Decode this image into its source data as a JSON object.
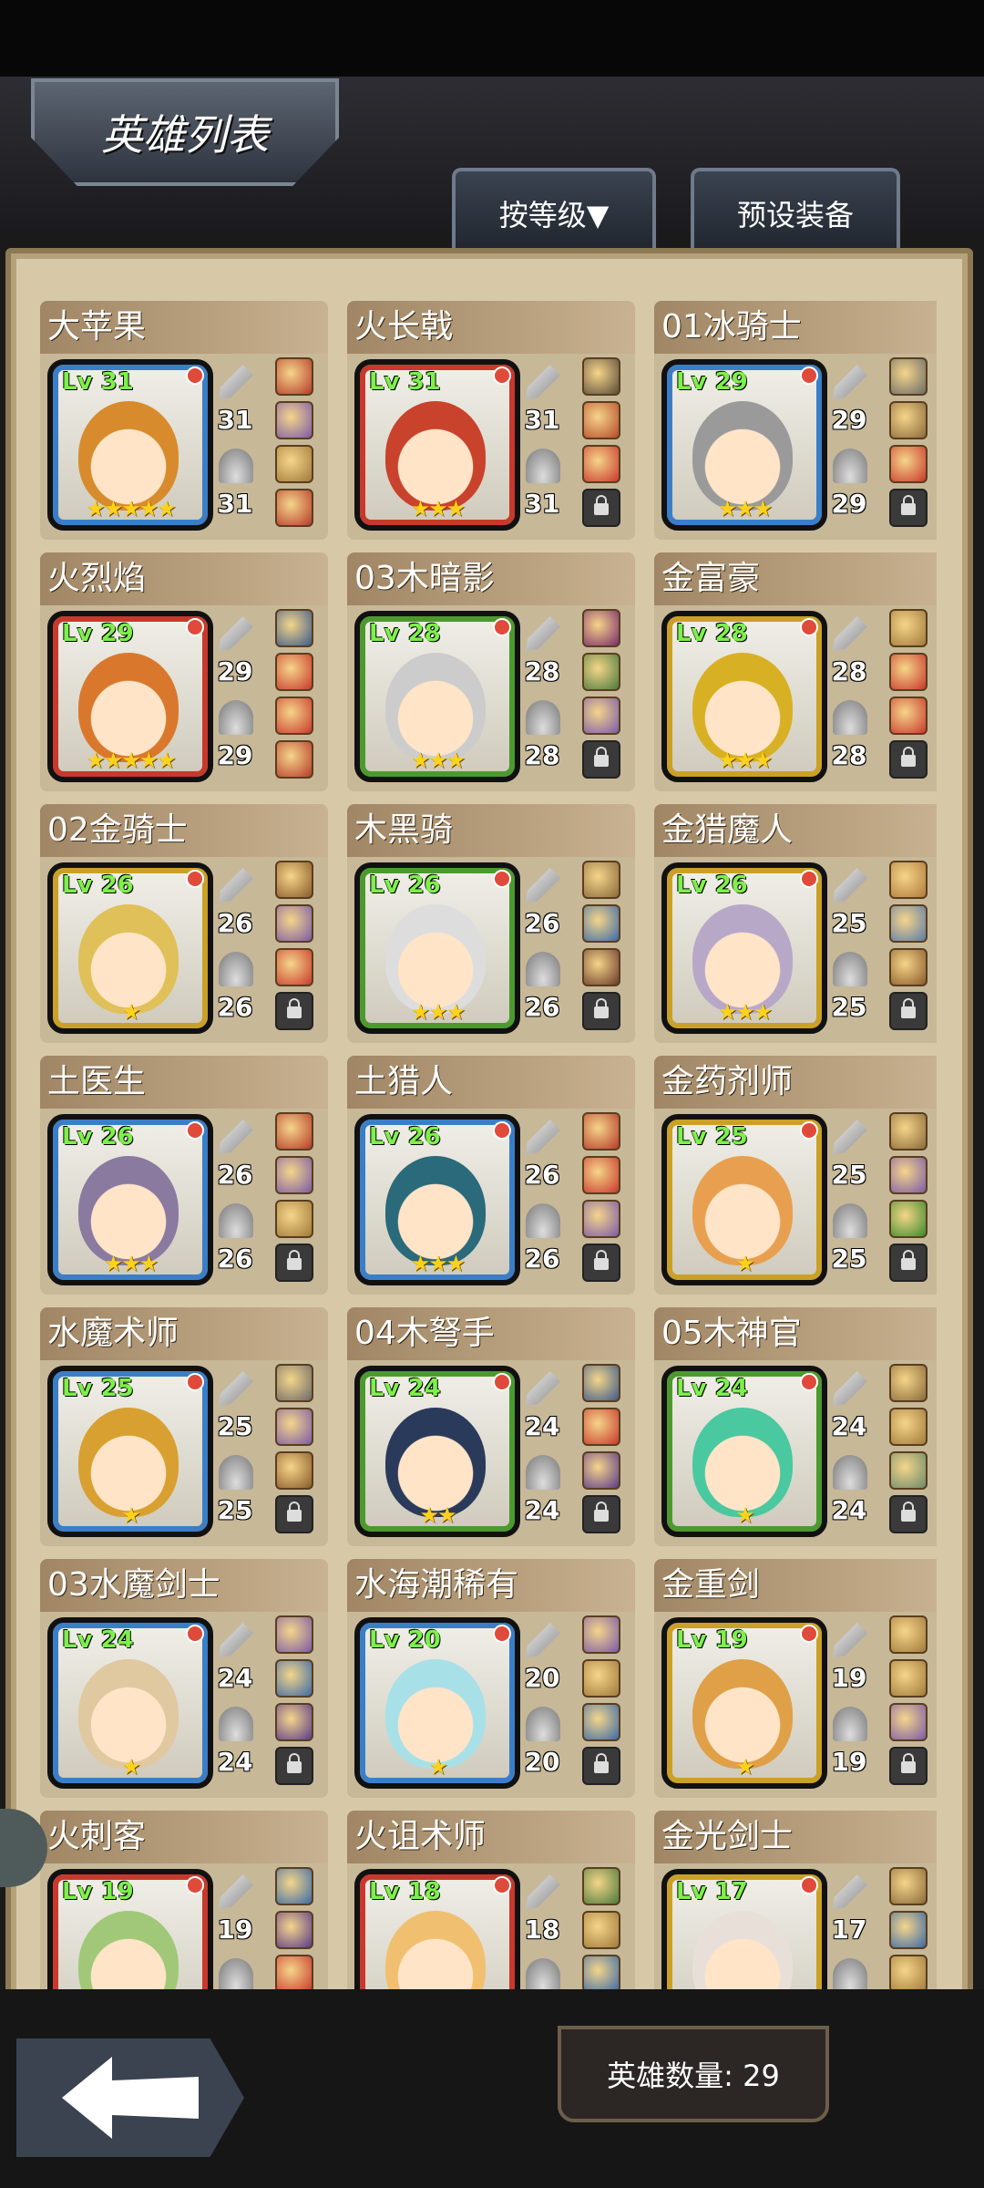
{
  "header": {
    "title": "英雄列表",
    "sort_label": "按等级▼",
    "preset_label": "预设装备"
  },
  "footer": {
    "hero_count": "英雄数量: 29"
  },
  "colors": {
    "blue": "#3b7ec8",
    "red": "#c9382c",
    "green": "#4c9a2e",
    "gold": "#caa126"
  },
  "heroes": [
    {
      "name": "大苹果",
      "level": "Lv 31",
      "stars": "★★★★★",
      "atk": "31",
      "def": "31",
      "frame": "blue",
      "hair": "#d88b2c",
      "equip": [
        "#b63a2a",
        "#7a5aa8",
        "#a07a3a",
        "#b63a2a"
      ]
    },
    {
      "name": "火长戟",
      "level": "Lv 31",
      "stars": "★★★",
      "atk": "31",
      "def": "31",
      "frame": "red",
      "hair": "#c9422c",
      "equip": [
        "#5a4a3a",
        "#b64a2a",
        "#c9382c",
        "lock"
      ]
    },
    {
      "name": "01冰骑士",
      "level": "Lv 29",
      "stars": "★★★",
      "atk": "29",
      "def": "29",
      "frame": "blue",
      "hair": "#9a9a9a",
      "equip": [
        "#6a6a6a",
        "#8a6a3a",
        "#c9382c",
        "lock"
      ]
    },
    {
      "name": "火烈焰",
      "level": "Lv 29",
      "stars": "★★★★★",
      "atk": "29",
      "def": "29",
      "frame": "red",
      "hair": "#d9782c",
      "equip": [
        "#3a5a8a",
        "#c9382c",
        "#c9382c",
        "#b63a2a"
      ]
    },
    {
      "name": "03木暗影",
      "level": "Lv 28",
      "stars": "★★★",
      "atk": "28",
      "def": "28",
      "frame": "green",
      "hair": "#cccccc",
      "equip": [
        "#7a2a6a",
        "#4a7a3a",
        "#7a5aa8",
        "lock"
      ]
    },
    {
      "name": "金富豪",
      "level": "Lv 28",
      "stars": "★★★",
      "atk": "28",
      "def": "28",
      "frame": "gold",
      "hair": "#d8b024",
      "equip": [
        "#a07a3a",
        "#c9382c",
        "#c9382c",
        "lock"
      ]
    },
    {
      "name": "02金骑士",
      "level": "Lv 26",
      "stars": "★",
      "atk": "26",
      "def": "26",
      "frame": "gold",
      "hair": "#e0c058",
      "equip": [
        "#8a5a2a",
        "#7a5aa8",
        "#c9382c",
        "lock"
      ]
    },
    {
      "name": "木黑骑",
      "level": "Lv 26",
      "stars": "★★★",
      "atk": "26",
      "def": "26",
      "frame": "green",
      "hair": "#dddddd",
      "equip": [
        "#8a6a3a",
        "#3a6aa8",
        "#6a3a2a",
        "lock"
      ]
    },
    {
      "name": "金猎魔人",
      "level": "Lv 26",
      "stars": "★★★",
      "atk": "25",
      "def": "25",
      "frame": "gold",
      "hair": "#b8a8c8",
      "equip": [
        "#b07a3a",
        "#5a7aa8",
        "#8a5a2a",
        "lock"
      ]
    },
    {
      "name": "土医生",
      "level": "Lv 26",
      "stars": "★★★",
      "atk": "26",
      "def": "26",
      "frame": "blue",
      "hair": "#8a7aa0",
      "equip": [
        "#b63a2a",
        "#7a5aa8",
        "#a07a3a",
        "lock"
      ]
    },
    {
      "name": "土猎人",
      "level": "Lv 26",
      "stars": "★★★",
      "atk": "26",
      "def": "26",
      "frame": "blue",
      "hair": "#2a6a7a",
      "equip": [
        "#b63a2a",
        "#c9382c",
        "#7a5aa8",
        "lock"
      ]
    },
    {
      "name": "金药剂师",
      "level": "Lv 25",
      "stars": "★",
      "atk": "25",
      "def": "25",
      "frame": "gold",
      "hair": "#e8a050",
      "equip": [
        "#8a6a3a",
        "#7a5aa8",
        "#3a8a2a",
        "lock"
      ]
    },
    {
      "name": "水魔术师",
      "level": "Lv 25",
      "stars": "★",
      "atk": "25",
      "def": "25",
      "frame": "blue",
      "hair": "#d8a030",
      "equip": [
        "#6a6a6a",
        "#7a5aa8",
        "#8a5a2a",
        "lock"
      ]
    },
    {
      "name": "04木弩手",
      "level": "Lv 24",
      "stars": "★★",
      "atk": "24",
      "def": "24",
      "frame": "green",
      "hair": "#2a3a5a",
      "equip": [
        "#3a5a8a",
        "#c9382c",
        "#5a3a8a",
        "lock"
      ]
    },
    {
      "name": "05木神官",
      "level": "Lv 24",
      "stars": "★",
      "atk": "24",
      "def": "24",
      "frame": "green",
      "hair": "#4ac8a0",
      "equip": [
        "#8a6a3a",
        "#a07a3a",
        "#6a8a6a",
        "lock"
      ]
    },
    {
      "name": "03水魔剑士",
      "level": "Lv 24",
      "stars": "★",
      "atk": "24",
      "def": "24",
      "frame": "blue",
      "hair": "#e0c8a0",
      "equip": [
        "#7a5aa8",
        "#3a6aa8",
        "#5a3a8a",
        "lock"
      ]
    },
    {
      "name": "水海潮稀有",
      "level": "Lv 20",
      "stars": "★",
      "atk": "20",
      "def": "20",
      "frame": "blue",
      "hair": "#a8e0e8",
      "equip": [
        "#7a5aa8",
        "#a07a3a",
        "#3a6aa8",
        "lock"
      ]
    },
    {
      "name": "金重剑",
      "level": "Lv 19",
      "stars": "★",
      "atk": "19",
      "def": "19",
      "frame": "gold",
      "hair": "#e0a048",
      "equip": [
        "#a07a3a",
        "#a07a3a",
        "#7a5aa8",
        "lock"
      ]
    },
    {
      "name": "火刺客",
      "level": "Lv 19",
      "stars": "",
      "atk": "19",
      "def": "",
      "frame": "red",
      "hair": "#a0c878",
      "equip": [
        "#3a6aa8",
        "#5a3a8a",
        "#c9382c",
        "lock"
      ]
    },
    {
      "name": "火诅术师",
      "level": "Lv 18",
      "stars": "",
      "atk": "18",
      "def": "",
      "frame": "red",
      "hair": "#f0c070",
      "equip": [
        "#4a7a3a",
        "#a07a3a",
        "#3a6aa8",
        "lock"
      ]
    },
    {
      "name": "金光剑士",
      "level": "Lv 17",
      "stars": "",
      "atk": "17",
      "def": "",
      "frame": "gold",
      "hair": "#e8e0d8",
      "equip": [
        "#8a6a3a",
        "#3a6aa8",
        "#a07a3a",
        "lock"
      ]
    }
  ]
}
